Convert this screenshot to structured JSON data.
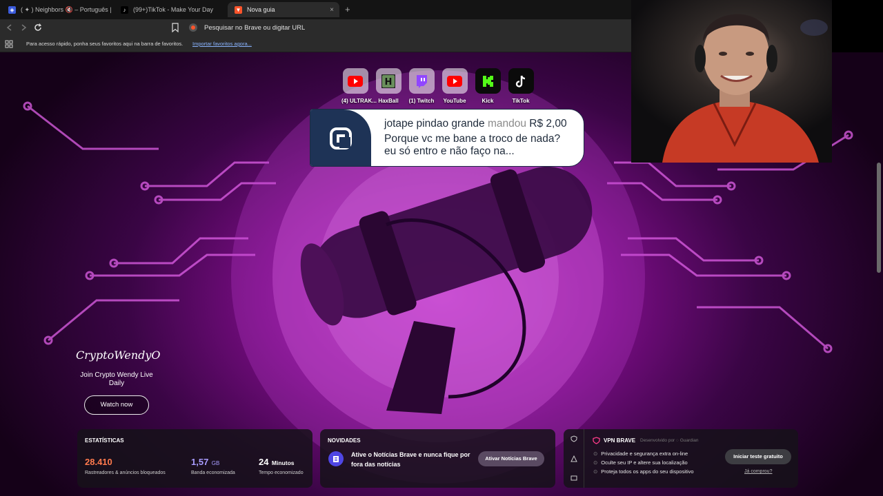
{
  "browser": {
    "tabs": [
      {
        "label": "( ✦ ) Neighbors 🔇 – Português | Site",
        "active": false
      },
      {
        "label": "(99+)TikTok - Make Your Day",
        "active": false
      },
      {
        "label": "Nova guia",
        "active": true
      }
    ],
    "new_tab_symbol": "+",
    "close_symbol": "×",
    "address_placeholder": "Pesquisar no Brave ou digitar URL",
    "bookmarks_hint": "Para acesso rápido, ponha seus favoritos aqui na barra de favoritos.",
    "bookmarks_import_link": "Importar favoritos agora..."
  },
  "shortcuts": [
    {
      "label": "(4) ULTRAK...",
      "icon": "youtube-icon"
    },
    {
      "label": "HaxBall",
      "icon": "haxball-icon"
    },
    {
      "label": "(1) Twitch",
      "icon": "twitch-icon"
    },
    {
      "label": "YouTube",
      "icon": "youtube-icon"
    },
    {
      "label": "Kick",
      "icon": "kick-icon"
    },
    {
      "label": "TikTok",
      "icon": "tiktok-icon"
    }
  ],
  "donation_alert": {
    "sender": "jotape pindao grande",
    "verb": "mandou",
    "amount": "R$ 2,00",
    "message": "Porque vc me bane a troco de nada? eu só entro e não faço na..."
  },
  "sponsor": {
    "brand": "CryptoWendyO",
    "tagline": "Join Crypto Wendy Live Daily",
    "cta": "Watch now"
  },
  "stats": {
    "title": "ESTATÍSTICAS",
    "items": [
      {
        "value": "28.410",
        "unit": "",
        "label": "Rastreadores & anúncios bloqueados",
        "color": "#ff7a4d"
      },
      {
        "value": "1,57",
        "unit": "GB",
        "label": "Banda economizada",
        "color": "#a99cff"
      },
      {
        "value": "24",
        "unit": "Minutos",
        "label": "Tempo economizado",
        "color": "#ffffff"
      }
    ]
  },
  "news": {
    "title": "NOVIDADES",
    "text": "Ative o Notícias Brave e nunca fique por fora das notícias",
    "button": "Ativar Notícias Brave"
  },
  "vpn": {
    "title": "VPN BRAVE",
    "developed_by": "Desenvolvido por",
    "partner": "Guardian",
    "features": [
      "Privacidade e segurança extra on-line",
      "Oculte seu IP e altere sua localização",
      "Proteja todos os apps do seu dispositivo"
    ],
    "button": "Iniciar teste gratuito",
    "link": "Já comprou?"
  },
  "colors": {
    "brave_accent": "#fb542b",
    "twitch": "#9146ff",
    "youtube": "#ff0000",
    "kick": "#53fc18",
    "news_icon": "#4f46e5"
  }
}
